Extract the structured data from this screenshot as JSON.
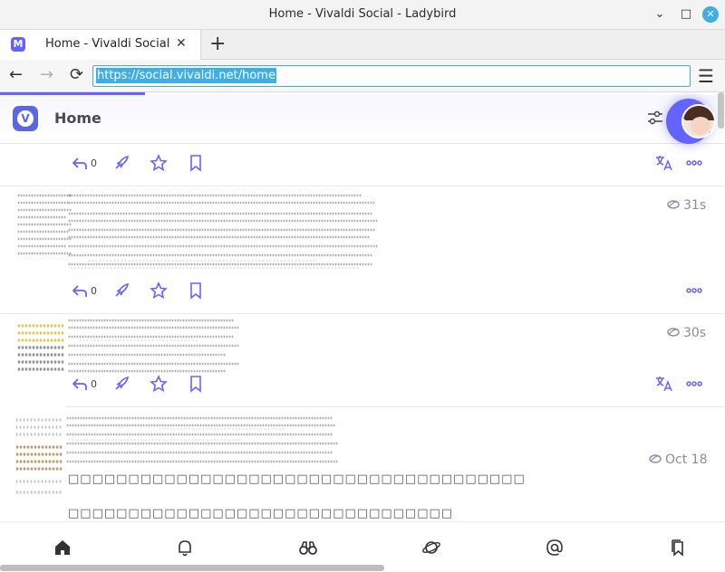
{
  "window": {
    "title": "Home - Vivaldi Social - Ladybird",
    "minimize": "⌄",
    "maximize": "□",
    "close": "✕"
  },
  "tabs": [
    {
      "label": "Home - Vivaldi Social",
      "favicon": "M",
      "close": "✕"
    }
  ],
  "new_tab": "+",
  "nav": {
    "back": "←",
    "forward": "→",
    "reload": "⟳",
    "url": "https://social.vivaldi.net/home",
    "menu": "☰"
  },
  "header": {
    "logo": "V",
    "title": "Home"
  },
  "posts": [
    {
      "reply_count": "0",
      "time": "",
      "has_translate": true
    },
    {
      "reply_count": "0",
      "time": "31s",
      "has_translate": false
    },
    {
      "reply_count": "0",
      "time": "30s",
      "has_translate": true
    },
    {
      "reply_count": "",
      "time": "Oct 18",
      "has_translate": false,
      "text_lines": [
        "□□□□□□□□□□□□□□□□□□□□□□□□□□□□□□□□□□□□□□",
        "□□□□□□□□□□□□□□□□□□□□□□□□□□□□□□□□"
      ]
    }
  ],
  "colors": {
    "accent": "#6364ff",
    "icon": "#6364ff",
    "meta": "#8a8aa3"
  },
  "bottom_nav": [
    "home-icon",
    "bell-icon",
    "binoculars-icon",
    "planet-icon",
    "at-icon",
    "bookmarks-icon"
  ]
}
